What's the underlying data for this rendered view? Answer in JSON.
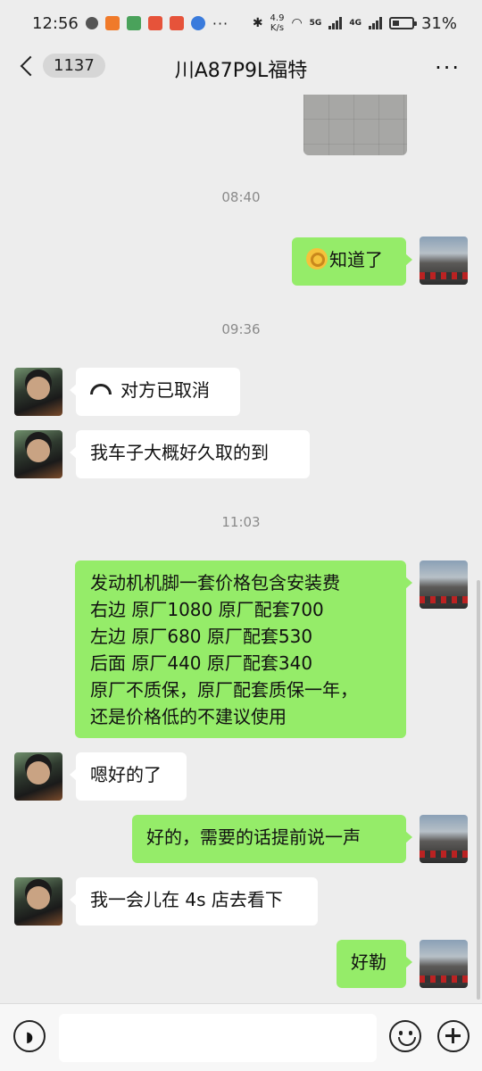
{
  "status_bar": {
    "time": "12:56",
    "net_speed_value": "4.9",
    "net_speed_unit": "K/s",
    "network_5g": "5G",
    "network_4g": "4G",
    "battery": "31%"
  },
  "header": {
    "unread_count": "1137",
    "title": "川A87P9L福特",
    "more": "···"
  },
  "messages": {
    "time_1": "08:40",
    "m1": "知道了",
    "time_2": "09:36",
    "m2": "对方已取消",
    "m3": "我车子大概好久取的到",
    "time_3": "11:03",
    "m4_lines": [
      "发动机机脚一套价格包含安装费",
      "右边 原厂1080 原厂配套700",
      "左边 原厂680 原厂配套530",
      "后面 原厂440 原厂配套340",
      "原厂不质保，原厂配套质保一年，",
      "还是价格低的不建议使用"
    ],
    "m5": "嗯好的了",
    "m6": "好的，需要的话提前说一声",
    "m7": "我一会儿在 4s 店去看下",
    "m8": "好勒"
  },
  "input_bar": {
    "placeholder": ""
  },
  "icons": {
    "back": "chevron-left-icon",
    "more": "more-dots-icon",
    "voice": "voice-icon",
    "emoji": "emoji-icon",
    "plus": "plus-icon",
    "call": "phone-hangup-icon",
    "ok": "ok-hand-emoji"
  },
  "colors": {
    "background": "#ededed",
    "my_bubble": "#95ec69",
    "other_bubble": "#ffffff"
  }
}
